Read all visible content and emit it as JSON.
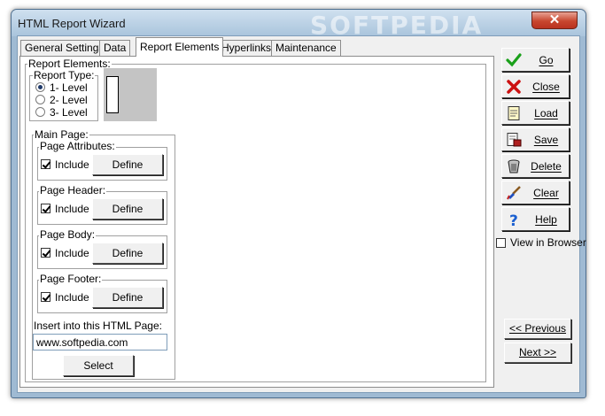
{
  "window": {
    "title": "HTML Report Wizard",
    "watermark": "SOFTPEDIA",
    "close_glyph": "✕"
  },
  "tabs": [
    {
      "label": "General Settings",
      "active": false
    },
    {
      "label": "Data",
      "active": false
    },
    {
      "label": "Report Elements",
      "active": true
    },
    {
      "label": "Hyperlinks",
      "active": false
    },
    {
      "label": "Maintenance",
      "active": false
    }
  ],
  "report_elements": {
    "label": "Report Elements:",
    "report_type": {
      "label": "Report Type:",
      "options": [
        "1- Level",
        "2- Level",
        "3- Level"
      ],
      "selected": "1- Level"
    }
  },
  "main_page": {
    "label": "Main Page:",
    "include_label": "Include",
    "define_label": "Define",
    "sections": [
      {
        "label": "Page Attributes:",
        "include": true
      },
      {
        "label": "Page Header:",
        "include": true
      },
      {
        "label": "Page Body:",
        "include": true
      },
      {
        "label": "Page Footer:",
        "include": true
      }
    ],
    "insert_label": "Insert into this HTML Page:",
    "insert_value": "www.softpedia.com",
    "select_label": "Select"
  },
  "side_buttons": [
    {
      "label": "Go",
      "icon": "checkmark-icon",
      "color": "#1aa01a"
    },
    {
      "label": "Close",
      "icon": "red-x-icon",
      "color": "#cc1111"
    },
    {
      "label": "Load",
      "icon": "document-icon",
      "color": "#b08a20"
    },
    {
      "label": "Save",
      "icon": "save-document-icon",
      "color": "#b02020"
    },
    {
      "label": "Delete",
      "icon": "trash-icon",
      "color": "#444444"
    },
    {
      "label": "Clear",
      "icon": "brush-icon",
      "color": "#c07020"
    },
    {
      "label": "Help",
      "icon": "question-icon",
      "color": "#1a5fd0"
    }
  ],
  "view_in_browser": {
    "label": "View in Browser",
    "checked": false
  },
  "nav": {
    "previous": "<< Previous",
    "next": "Next >>"
  }
}
